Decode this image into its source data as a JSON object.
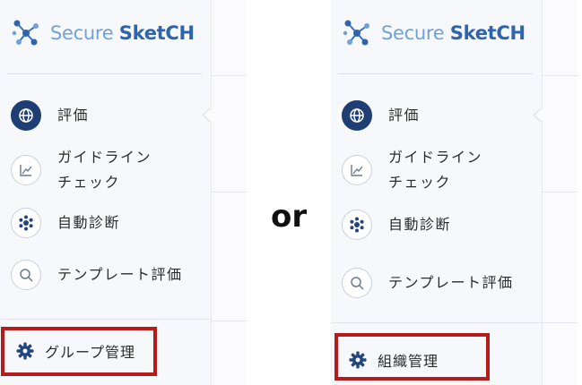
{
  "left_panel": {
    "brand": {
      "part1": "Secure ",
      "part2": "SketCH"
    },
    "nav": [
      {
        "label": "評価",
        "icon": "globe-icon",
        "active": true
      },
      {
        "label": "ガイドライン\nチェック",
        "icon": "chart-icon",
        "active": false
      },
      {
        "label": "自動診断",
        "icon": "gear-spin-icon",
        "active": false
      },
      {
        "label": "テンプレート評価",
        "icon": "search-icon",
        "active": false
      }
    ],
    "settings": {
      "label": "グループ管理",
      "icon": "gear-icon"
    }
  },
  "separator": {
    "label": "or"
  },
  "right_panel": {
    "brand": {
      "part1": "Secure ",
      "part2": "SketCH"
    },
    "nav": [
      {
        "label": "評価",
        "icon": "globe-icon",
        "active": true
      },
      {
        "label": "ガイドライン\nチェック",
        "icon": "chart-icon",
        "active": false
      },
      {
        "label": "自動診断",
        "icon": "gear-spin-icon",
        "active": false
      },
      {
        "label": "テンプレート評価",
        "icon": "search-icon",
        "active": false
      }
    ],
    "settings": {
      "label": "組織管理",
      "icon": "gear-icon"
    }
  },
  "colors": {
    "brand_light": "#6fa2d9",
    "brand_dark": "#2f63ac",
    "active_icon_bg": "#1f3f74",
    "highlight": "#b51b1b"
  }
}
